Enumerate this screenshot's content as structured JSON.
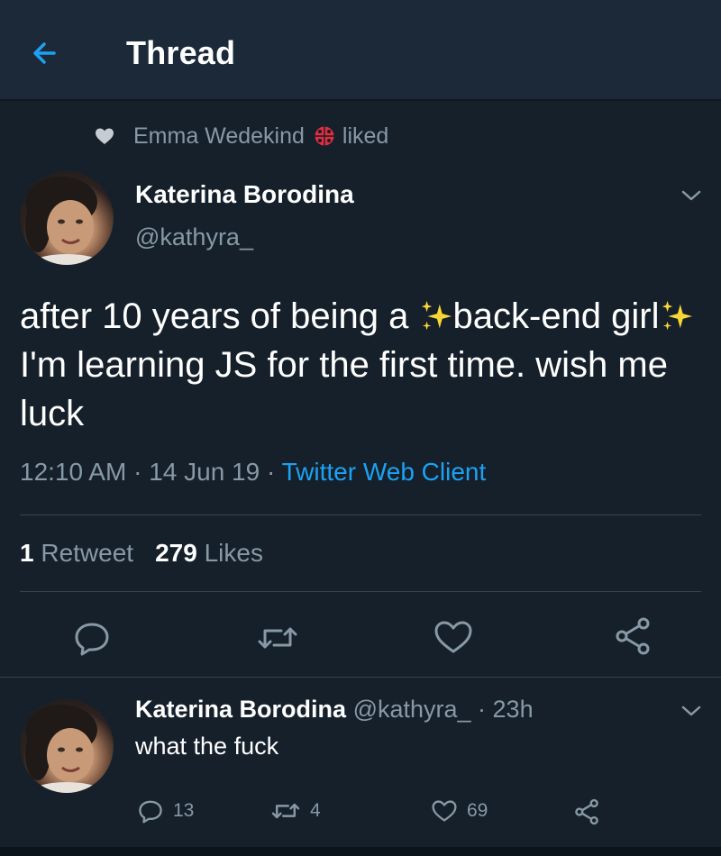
{
  "header": {
    "title": "Thread",
    "back_icon": "arrow-left-icon"
  },
  "social_context": {
    "name": "Emma Wedekind",
    "verb": "liked",
    "icon": "heart-icon",
    "emoji": "ladybug-emoji"
  },
  "tweet": {
    "author_name": "Katerina Borodina",
    "handle": "@kathyra_",
    "text_parts": [
      "after 10 years of being a ",
      "back-end girl",
      "I'm learning JS for the first time. wish me luck"
    ],
    "emoji": "sparkles-emoji",
    "time": "12:10 AM",
    "date": "14 Jun 19",
    "client": "Twitter Web Client",
    "retweets_count": "1",
    "retweets_label": "Retweet",
    "likes_count": "279",
    "likes_label": "Likes"
  },
  "reply": {
    "author_name": "Katerina Borodina",
    "handle": "@kathyra_",
    "age": "23h",
    "text": "what the fuck",
    "reply_count": "13",
    "retweet_count": "4",
    "like_count": "69"
  },
  "colors": {
    "background": "#15202b",
    "header": "#1c2938",
    "muted": "#8899a6",
    "accent": "#1da1f2",
    "divider": "#38444d"
  }
}
